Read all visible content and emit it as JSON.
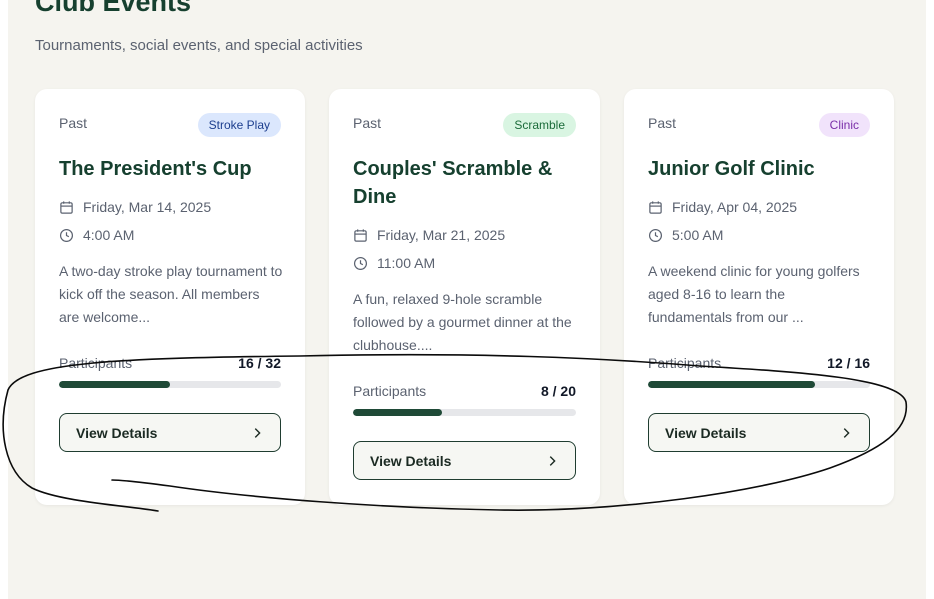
{
  "header": {
    "title": "Club Events",
    "subtitle": "Tournaments, social events, and special activities"
  },
  "events": [
    {
      "status": "Past",
      "badge": "Stroke Play",
      "title": "The President's Cup",
      "date": "Friday, Mar 14, 2025",
      "time": "4:00 AM",
      "description": "A two-day stroke play tournament to kick off the season. All members are welcome...",
      "participants_label": "Participants",
      "participants_count": "16 / 32",
      "participants_fraction": 0.5,
      "button_label": "View Details"
    },
    {
      "status": "Past",
      "badge": "Scramble",
      "title": "Couples' Scramble & Dine",
      "date": "Friday, Mar 21, 2025",
      "time": "11:00 AM",
      "description": "A fun, relaxed 9-hole scramble followed by a gourmet dinner at the clubhouse....",
      "participants_label": "Participants",
      "participants_count": "8 / 20",
      "participants_fraction": 0.4,
      "button_label": "View Details"
    },
    {
      "status": "Past",
      "badge": "Clinic",
      "title": "Junior Golf Clinic",
      "date": "Friday, Apr 04, 2025",
      "time": "5:00 AM",
      "description": "A weekend clinic for young golfers aged 8-16 to learn the fundamentals from our ...",
      "participants_label": "Participants",
      "participants_count": "12 / 16",
      "participants_fraction": 0.75,
      "button_label": "View Details"
    }
  ],
  "icons": {
    "date": "calendar-icon",
    "time": "clock-icon",
    "button": "chevron-right-icon"
  },
  "colors": {
    "brand": "#16402f",
    "progress": "#1f4a37",
    "background": "#f5f4ef"
  }
}
